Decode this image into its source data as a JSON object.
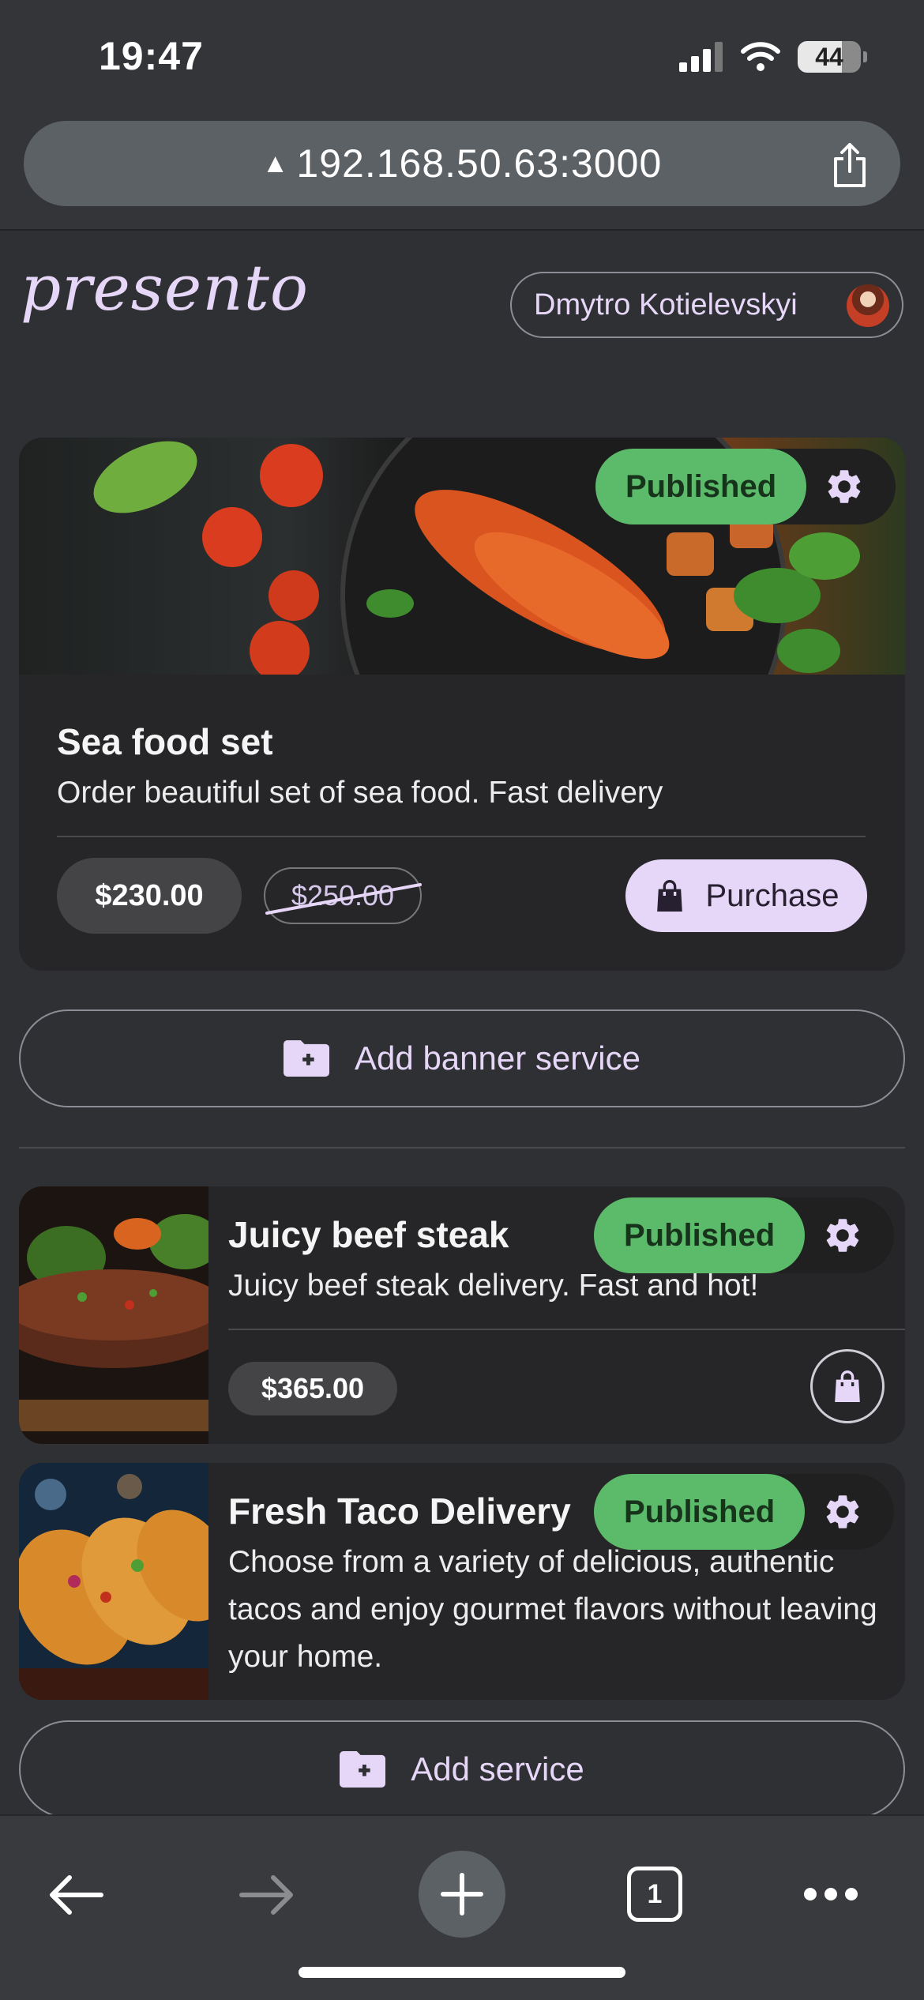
{
  "status_bar": {
    "time": "19:47",
    "battery": "44"
  },
  "browser": {
    "url": "192.168.50.63:3000"
  },
  "header": {
    "logo": "presento",
    "user_name": "Dmytro Kotielevskyi"
  },
  "banner_card": {
    "status": "Published",
    "title": "Sea food set",
    "description": "Order beautiful set of sea food. Fast delivery",
    "price": "$230.00",
    "old_price": "$250.00",
    "purchase_label": "Purchase"
  },
  "add_banner_label": "Add banner service",
  "services": [
    {
      "title": "Juicy beef steak",
      "status": "Published",
      "description": "Juicy beef steak delivery. Fast and hot!",
      "price": "$365.00"
    },
    {
      "title": "Fresh Taco Delivery",
      "status": "Published",
      "description": "Choose from a variety of delicious, authentic tacos and enjoy gourmet flavors without leaving your home."
    }
  ],
  "add_service_label": "Add service",
  "bottom_bar": {
    "tabs_count": "1"
  },
  "colors": {
    "accent": "#e6d6f7",
    "published": "#5cbb6a",
    "card": "#262628",
    "background": "#2f3033"
  }
}
